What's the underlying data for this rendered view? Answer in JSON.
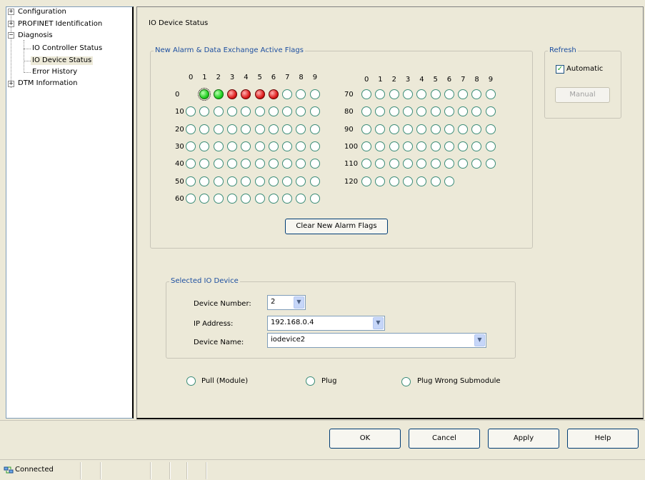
{
  "tree": {
    "items": [
      {
        "label": "Configuration",
        "expander": "+"
      },
      {
        "label": "PROFINET Identification",
        "expander": "+"
      },
      {
        "label": "Diagnosis",
        "expander": "−"
      },
      {
        "label": "IO Controller Status"
      },
      {
        "label": "IO Device Status",
        "selected": true
      },
      {
        "label": "Error History"
      },
      {
        "label": "DTM Information",
        "expander": "+"
      }
    ]
  },
  "panel": {
    "title": "IO Device Status",
    "flags_group": "New Alarm & Data Exchange Active Flags",
    "left_col_headers": [
      "0",
      "1",
      "2",
      "3",
      "4",
      "5",
      "6",
      "7",
      "8",
      "9"
    ],
    "right_col_headers": [
      "0",
      "1",
      "2",
      "3",
      "4",
      "5",
      "6",
      "7",
      "8",
      "9"
    ],
    "left_rows": [
      {
        "label": "0",
        "states": [
          "focus-green",
          "green",
          "red",
          "red",
          "red",
          "red",
          "empty",
          "empty",
          "empty"
        ]
      },
      {
        "label": "10"
      },
      {
        "label": "20"
      },
      {
        "label": "30"
      },
      {
        "label": "40"
      },
      {
        "label": "50"
      },
      {
        "label": "60"
      }
    ],
    "right_rows": [
      {
        "label": "70",
        "count": 10
      },
      {
        "label": "80",
        "count": 10
      },
      {
        "label": "90",
        "count": 10
      },
      {
        "label": "100",
        "count": 10
      },
      {
        "label": "110",
        "count": 10
      },
      {
        "label": "120",
        "count": 7
      }
    ],
    "clear_button": "Clear New Alarm Flags",
    "refresh_group": "Refresh",
    "automatic_label": "Automatic",
    "automatic_checked": true,
    "manual_button": "Manual",
    "device_group": "Selected IO Device",
    "device_number_label": "Device Number:",
    "device_number_value": "2",
    "ip_label": "IP Address:",
    "ip_value": "192.168.0.4",
    "device_name_label": "Device Name:",
    "device_name_value": "iodevice2",
    "radio_pull": "Pull (Module)",
    "radio_plug": "Plug",
    "radio_plug_wrong": "Plug Wrong Submodule"
  },
  "footer": {
    "ok": "OK",
    "cancel": "Cancel",
    "apply": "Apply",
    "help": "Help"
  },
  "status": {
    "text": "Connected",
    "icon": "network-connected-icon"
  },
  "colors": {
    "legend_blue": "#1d4fa0",
    "led_green": "#22d022",
    "led_red": "#e02020",
    "led_off_border": "#3c8d78"
  }
}
